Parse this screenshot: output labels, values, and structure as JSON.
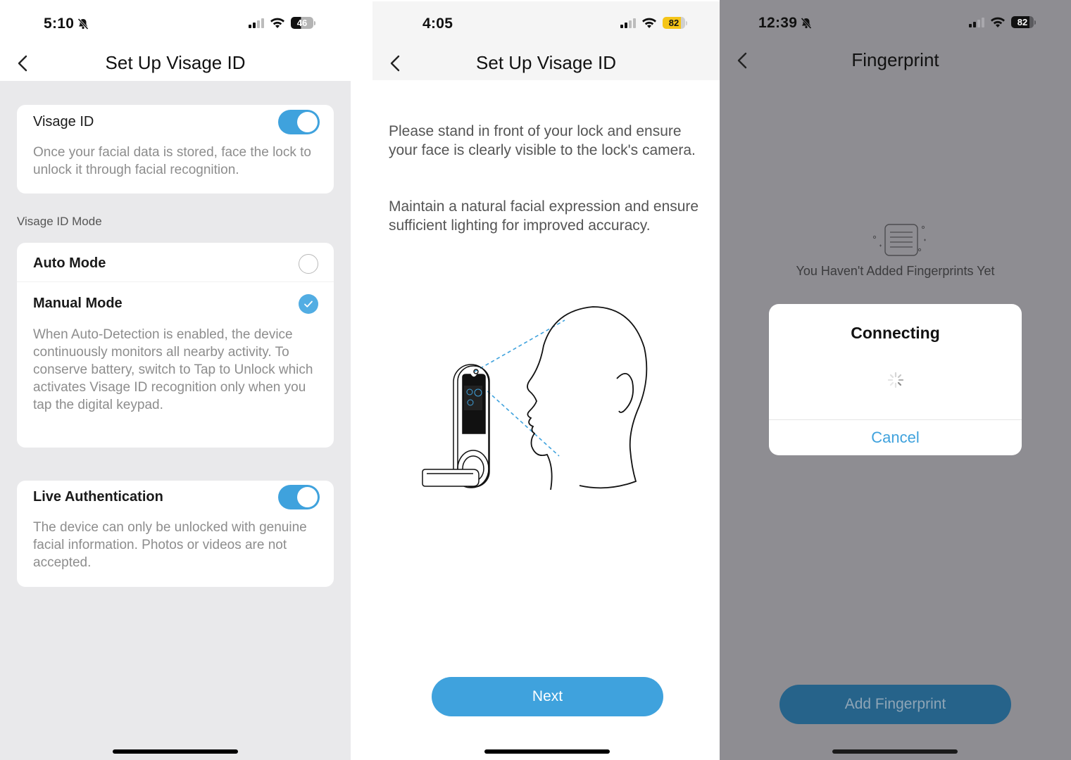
{
  "screens": [
    {
      "status": {
        "time": "5:10",
        "silent": true,
        "battery": "46"
      },
      "nav": {
        "title": "Set Up Visage ID"
      },
      "visage_card": {
        "title": "Visage ID",
        "toggle_on": true,
        "description": "Once your facial data is stored, face the lock to unlock it through facial recognition."
      },
      "mode_section_label": "Visage ID Mode",
      "modes": [
        {
          "label": "Auto Mode",
          "selected": false
        },
        {
          "label": "Manual Mode",
          "selected": true
        }
      ],
      "mode_description": "When Auto-Detection is enabled, the device continuously monitors all nearby activity. To conserve battery, switch to Tap to Unlock which activates Visage ID recognition only when you tap the digital keypad.",
      "live_card": {
        "title": "Live Authentication",
        "toggle_on": true,
        "description": "The device can only be unlocked with genuine facial information. Photos or videos are not accepted."
      }
    },
    {
      "status": {
        "time": "4:05",
        "silent": false,
        "battery": "82"
      },
      "nav": {
        "title": "Set Up Visage ID"
      },
      "instructions": [
        "Please stand in front of your lock and ensure your face is clearly visible to the lock's camera.",
        "Maintain a natural facial expression and ensure sufficient lighting for improved accuracy."
      ],
      "illustration": "lock-face-scan-illustration",
      "next_label": "Next"
    },
    {
      "status": {
        "time": "12:39",
        "silent": true,
        "battery": "82"
      },
      "nav": {
        "title": "Fingerprint"
      },
      "empty_text": "You Haven't Added Fingerprints Yet",
      "dialog": {
        "title": "Connecting",
        "cancel_label": "Cancel"
      },
      "add_label": "Add Fingerprint"
    }
  ],
  "colors": {
    "accent": "#3fa2dd",
    "accent_dimmed": "#26638a",
    "battery_low_power": "#f5c518",
    "settings_bg": "#e9e9eb",
    "overlay_bg": "#8e8d92"
  }
}
